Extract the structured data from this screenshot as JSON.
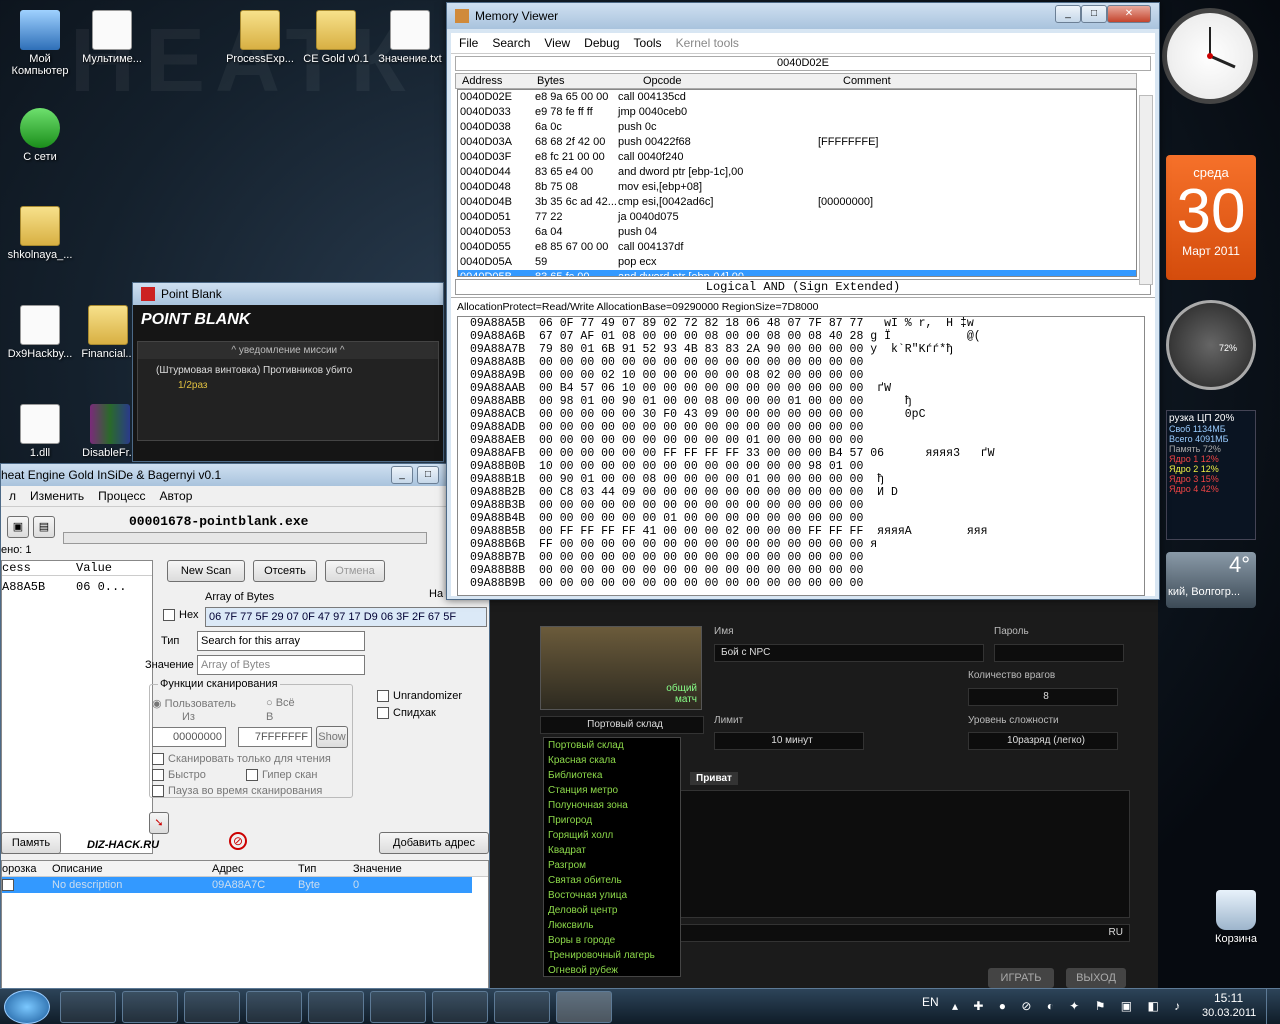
{
  "desktop": {
    "icons": [
      "Мой Компьютер",
      "Мультиме...",
      "ProcessExp...",
      "CE Gold v0.1",
      "Значение.txt",
      "С сети",
      "shkolnaya_...",
      "Dx9Hackby...",
      "Financial...",
      "1.dll",
      "DisableFr..."
    ],
    "bin": "Корзина"
  },
  "memview": {
    "title": "Memory Viewer",
    "menu": [
      "File",
      "Search",
      "View",
      "Debug",
      "Tools",
      "Kernel tools"
    ],
    "address_bar": "0040D02E",
    "columns": [
      "Address",
      "Bytes",
      "Opcode",
      "Comment"
    ],
    "rows": [
      [
        "0040D02E",
        "e8 9a 65 00 00",
        "call 004135cd",
        ""
      ],
      [
        "0040D033",
        "e9 78 fe ff ff",
        "jmp 0040ceb0",
        ""
      ],
      [
        "0040D038",
        "6a 0c",
        "push 0c",
        ""
      ],
      [
        "0040D03A",
        "68 68 2f 42 00",
        "push 00422f68",
        "[FFFFFFFE]"
      ],
      [
        "0040D03F",
        "e8 fc 21 00 00",
        "call 0040f240",
        ""
      ],
      [
        "0040D044",
        "83 65 e4 00",
        "and dword ptr [ebp-1c],00",
        ""
      ],
      [
        "0040D048",
        "8b 75 08",
        "mov esi,[ebp+08]",
        ""
      ],
      [
        "0040D04B",
        "3b 35 6c ad 42...",
        "cmp esi,[0042ad6c]",
        "[00000000]"
      ],
      [
        "0040D051",
        "77 22",
        "ja 0040d075",
        ""
      ],
      [
        "0040D053",
        "6a 04",
        "push 04",
        ""
      ],
      [
        "0040D055",
        "e8 85 67 00 00",
        "call 004137df",
        ""
      ],
      [
        "0040D05A",
        "59",
        "pop ecx",
        ""
      ],
      [
        "0040D05B",
        "83 65 fc 00",
        "and dword ptr [ebp-04],00",
        ""
      ]
    ],
    "status": "Logical AND (Sign Extended)",
    "alloc_info": "AllocationProtect=Read/Write  AllocationBase=09290000 RegionSize=7D8000",
    "hex_rows": [
      "09A88A5B  06 0F 77 49 07 89 02 72 82 18 06 48 07 7F 87 77   wI % r,  H ‡w",
      "09A88A6B  67 07 AF 01 08 00 00 00 08 00 00 08 00 08 40 28 g Ї           @(",
      "09A88A7B  79 80 01 6B 91 52 93 4B 83 83 2A 90 00 00 00 00 y  k`R\"Kѓѓ*ђ",
      "09A88A8B  00 00 00 00 00 00 00 00 00 00 00 00 00 00 00 00",
      "09A88A9B  00 00 00 02 10 00 00 00 00 00 08 02 00 00 00 00",
      "09A88AAB  00 B4 57 06 10 00 00 00 00 00 00 00 00 00 00 00  ґW",
      "09A88ABB  00 98 01 00 90 01 00 00 08 00 00 00 01 00 00 00      ђ",
      "09A88ACB  00 00 00 00 00 30 F0 43 09 00 00 00 00 00 00 00      0рC",
      "09A88ADB  00 00 00 00 00 00 00 00 00 00 00 00 00 00 00 00",
      "09A88AEB  00 00 00 00 00 00 00 00 00 00 01 00 00 00 00 00",
      "09A88AFB  00 00 00 00 00 00 FF FF FF FF 33 00 00 00 B4 57 06      яяяя3   ґW",
      "09A88B0B  10 00 00 00 00 00 00 00 00 00 00 00 00 98 01 00",
      "09A88B1B  00 90 01 00 00 08 00 00 00 00 01 00 00 00 00 00  ђ",
      "09A88B2B  00 C8 03 44 09 00 00 00 00 00 00 00 00 00 00 00  И D",
      "09A88B3B  00 00 00 00 00 00 00 00 00 00 00 00 00 00 00 00",
      "09A88B4B  00 00 00 00 00 00 01 00 00 00 00 00 00 00 00 00",
      "09A88B5B  00 FF FF FF FF 41 00 00 00 02 00 00 00 FF FF FF  яяяяA        яяя",
      "09A88B6B  FF 00 00 00 00 00 00 00 00 00 00 00 00 00 00 00 я",
      "09A88B7B  00 00 00 00 00 00 00 00 00 00 00 00 00 00 00 00",
      "09A88B8B  00 00 00 00 00 00 00 00 00 00 00 00 00 00 00 00",
      "09A88B9B  00 00 00 00 00 00 00 00 00 00 00 00 00 00 00 00"
    ]
  },
  "pointblank": {
    "title": "Point Blank",
    "logo": "POINT BLANK",
    "mission_header": "^ уведомление миссии ^",
    "mission_text": "(Штурмовая винтовка) Противников убито",
    "mission_progress": "1/2раз"
  },
  "ce": {
    "title": "heat Engine Gold InSiDe & Bagernyi v0.1",
    "menu": [
      "л",
      "Изменить",
      "Процесс",
      "Автор"
    ],
    "process": "00001678-pointblank.exe",
    "found": "ено: 1",
    "list_headers": [
      "cess",
      "Value"
    ],
    "list_row": [
      "A88A5B",
      "06 0..."
    ],
    "new_scan": "New Scan",
    "filter": "Отсеять",
    "cancel": "Отмена",
    "array_label": "Array of Bytes",
    "hex_label": "Hex",
    "hex_value": "06 7F 77 5F 29 07 0F 47 97 17 D9 06 3F 2F 67 5F",
    "type_label": "Тип",
    "type_value": "Search for this array",
    "value_label": "Значение",
    "value_value": "Array of Bytes",
    "scan_funcs": "Функции сканирования",
    "user": "Пользователь",
    "all": "Всё",
    "from": "Из",
    "to": "В",
    "from_val": "00000000",
    "to_val": "7FFFFFFF",
    "show": "Show",
    "readonly": "Сканировать только для чтения",
    "fast": "Быстро",
    "hyper": "Гипер скан",
    "pause": "Пауза во время сканирования",
    "unrandomizer": "Unrandomizer",
    "speedhack": "Спидхак",
    "memory_btn": "Память",
    "site": "DIZ-HACK.RU",
    "add_addr": "Добавить адрес",
    "na": "На",
    "table_headers": [
      "орозка",
      "Описание",
      "Адрес",
      "Тип",
      "Значение"
    ],
    "table_row": [
      "No description",
      "09A88A7C",
      "Byte",
      "0"
    ]
  },
  "game": {
    "name_label": "Имя",
    "name_value": "Бой с NPC",
    "pass_label": "Пароль",
    "enemies_label": "Количество врагов",
    "enemies_value": "8",
    "limit_label": "Лимит",
    "limit_value": "10 минут",
    "difficulty_label": "Уровень сложности",
    "difficulty_value": "10разряд (легко)",
    "map_badge": "общий матч",
    "map_selected": "Портовый склад",
    "private": "Приват",
    "ru": "RU",
    "play": "ИГРАТЬ",
    "exit": "ВЫХОД",
    "maps": [
      "Портовый склад",
      "Красная скала",
      "Библиотека",
      "Станция метро",
      "Полуночная зона",
      "Пригород",
      "Горящий холл",
      "Квадрат",
      "Разгром",
      "Святая обитель",
      "Восточная улица",
      "Деловой центр",
      "Люксвиль",
      "Воры в городе",
      "Тренировочный лагерь",
      "Огневой рубеж"
    ]
  },
  "gadgets": {
    "day": "среда",
    "date": "30",
    "month": "Март 2011",
    "cpu_title": "рузка ЦП  20%",
    "mem_free": "Своб 1134МБ",
    "mem_total": "Всего 4091МБ",
    "mem_pct": "Память  72%",
    "cores": [
      "Ядро 1  12%",
      "Ядро 2  12%",
      "Ядро 3  15%",
      "Ядро 4  42%"
    ],
    "gauge": "72%",
    "weather_temp": "4°",
    "weather_city": "кий, Волгогр..."
  },
  "taskbar": {
    "lang": "EN",
    "time": "15:11",
    "date": "30.03.2011"
  }
}
